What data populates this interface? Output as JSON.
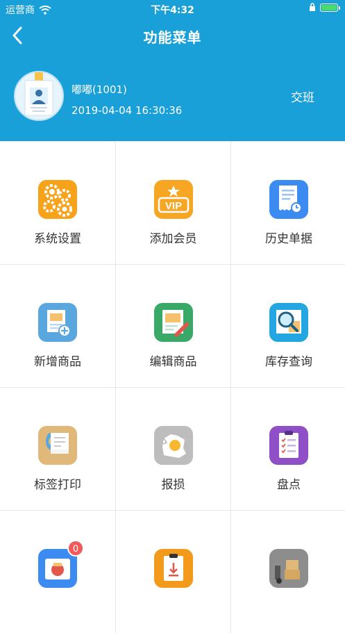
{
  "status_bar": {
    "carrier": "运营商",
    "time": "下午4:32"
  },
  "nav": {
    "title": "功能菜单"
  },
  "profile": {
    "name": "嘟嘟(1001)",
    "datetime": "2019-04-04 16:30:36",
    "shift_label": "交班"
  },
  "menu": [
    {
      "label": "系统设置",
      "icon": "gears-icon",
      "color": "#f7a21b"
    },
    {
      "label": "添加会员",
      "icon": "vip-icon",
      "color": "#f6a623"
    },
    {
      "label": "历史单据",
      "icon": "receipt-icon",
      "color": "#3c8bf0"
    },
    {
      "label": "新增商品",
      "icon": "add-product-icon",
      "color": "#5aa7e0"
    },
    {
      "label": "编辑商品",
      "icon": "edit-product-icon",
      "color": "#3aa866"
    },
    {
      "label": "库存查询",
      "icon": "inventory-search-icon",
      "color": "#24a6e0"
    },
    {
      "label": "标签打印",
      "icon": "label-print-icon",
      "color": "#e0b97a"
    },
    {
      "label": "报损",
      "icon": "damage-report-icon",
      "color": "#bdbdbd"
    },
    {
      "label": "盘点",
      "icon": "stocktake-icon",
      "color": "#8e4fc7"
    },
    {
      "label": "",
      "icon": "delivery-icon",
      "color": "#3c8bf0",
      "badge": "0"
    },
    {
      "label": "",
      "icon": "download-icon",
      "color": "#f39a1c"
    },
    {
      "label": "",
      "icon": "warehouse-icon",
      "color": "#8d8d8d"
    }
  ]
}
